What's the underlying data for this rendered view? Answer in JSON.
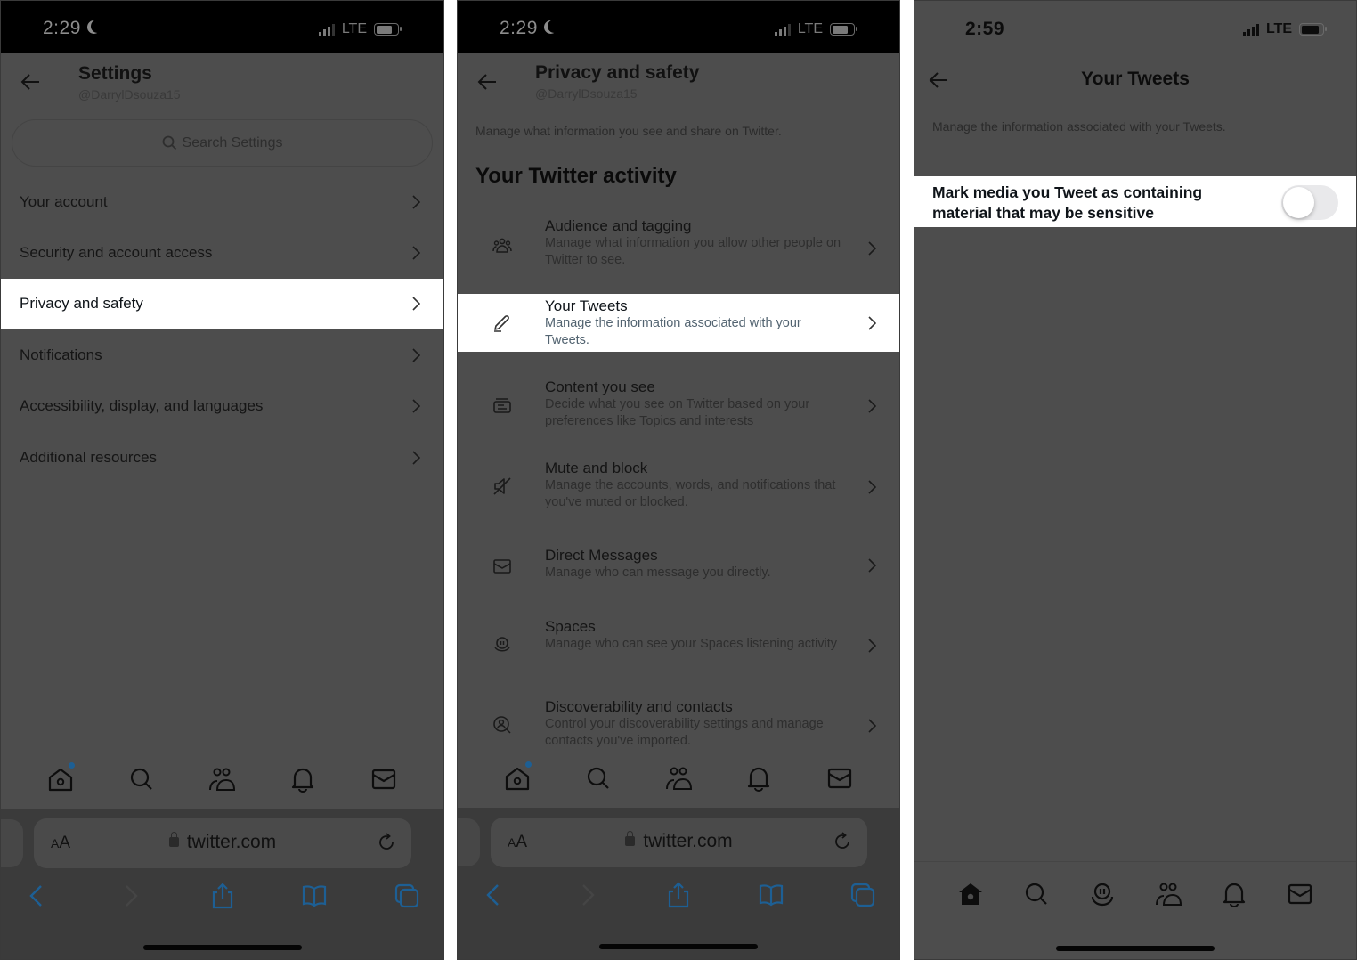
{
  "panels": [
    {
      "status": {
        "time": "2:29",
        "carrier": "LTE",
        "do_not_disturb": true
      },
      "header": {
        "title": "Settings",
        "handle": "@DarrylDsouza15"
      },
      "search": {
        "placeholder": "Search Settings"
      },
      "menu": [
        {
          "label": "Your account",
          "highlighted": false
        },
        {
          "label": "Security and account access",
          "highlighted": false
        },
        {
          "label": "Privacy and safety",
          "highlighted": true
        },
        {
          "label": "Notifications",
          "highlighted": false
        },
        {
          "label": "Accessibility, display, and languages",
          "highlighted": false
        },
        {
          "label": "Additional resources",
          "highlighted": false
        }
      ],
      "tabs": [
        "home-icon",
        "search-icon",
        "communities-icon",
        "bell-icon",
        "mail-icon"
      ],
      "safari": {
        "text_size": "AA",
        "url": "twitter.com"
      }
    },
    {
      "status": {
        "time": "2:29",
        "carrier": "LTE",
        "do_not_disturb": true
      },
      "header": {
        "title": "Privacy and safety",
        "handle": "@DarrylDsouza15"
      },
      "description": "Manage what information you see and share on Twitter.",
      "section_title": "Your Twitter activity",
      "items": [
        {
          "icon": "audience-icon",
          "title": "Audience and tagging",
          "desc": "Manage what information you allow other people on Twitter to see.",
          "highlighted": false
        },
        {
          "icon": "pencil-icon",
          "title": "Your Tweets",
          "desc": "Manage the information associated with your Tweets.",
          "highlighted": true
        },
        {
          "icon": "content-icon",
          "title": "Content you see",
          "desc": "Decide what you see on Twitter based on your preferences like Topics and interests",
          "highlighted": false
        },
        {
          "icon": "mute-icon",
          "title": "Mute and block",
          "desc": "Manage the accounts, words, and notifications that you've muted or blocked.",
          "highlighted": false
        },
        {
          "icon": "mail-icon",
          "title": "Direct Messages",
          "desc": "Manage who can message you directly.",
          "highlighted": false
        },
        {
          "icon": "spaces-icon",
          "title": "Spaces",
          "desc": "Manage who can see your Spaces listening activity",
          "highlighted": false
        },
        {
          "icon": "discoverability-icon",
          "title": "Discoverability and contacts",
          "desc": "Control your discoverability settings and manage contacts you've imported.",
          "highlighted": false
        }
      ],
      "tabs": [
        "home-icon",
        "search-icon",
        "communities-icon",
        "bell-icon",
        "mail-icon"
      ],
      "safari": {
        "text_size": "AA",
        "url": "twitter.com"
      }
    },
    {
      "status": {
        "time": "2:59",
        "carrier": "LTE"
      },
      "header": {
        "title": "Your Tweets"
      },
      "description": "Manage the information associated with your Tweets.",
      "setting": {
        "label": "Mark media you Tweet as containing material that may be sensitive",
        "enabled": false
      },
      "tabs": [
        "home-icon",
        "search-icon",
        "spaces-icon",
        "communities-icon",
        "bell-icon",
        "mail-icon"
      ]
    }
  ],
  "colors": {
    "dim_overlay": "#4d4d4d",
    "highlight": "#ffffff",
    "notification_dot": "#1d5f94",
    "safari_blue": "#1d5f94"
  }
}
